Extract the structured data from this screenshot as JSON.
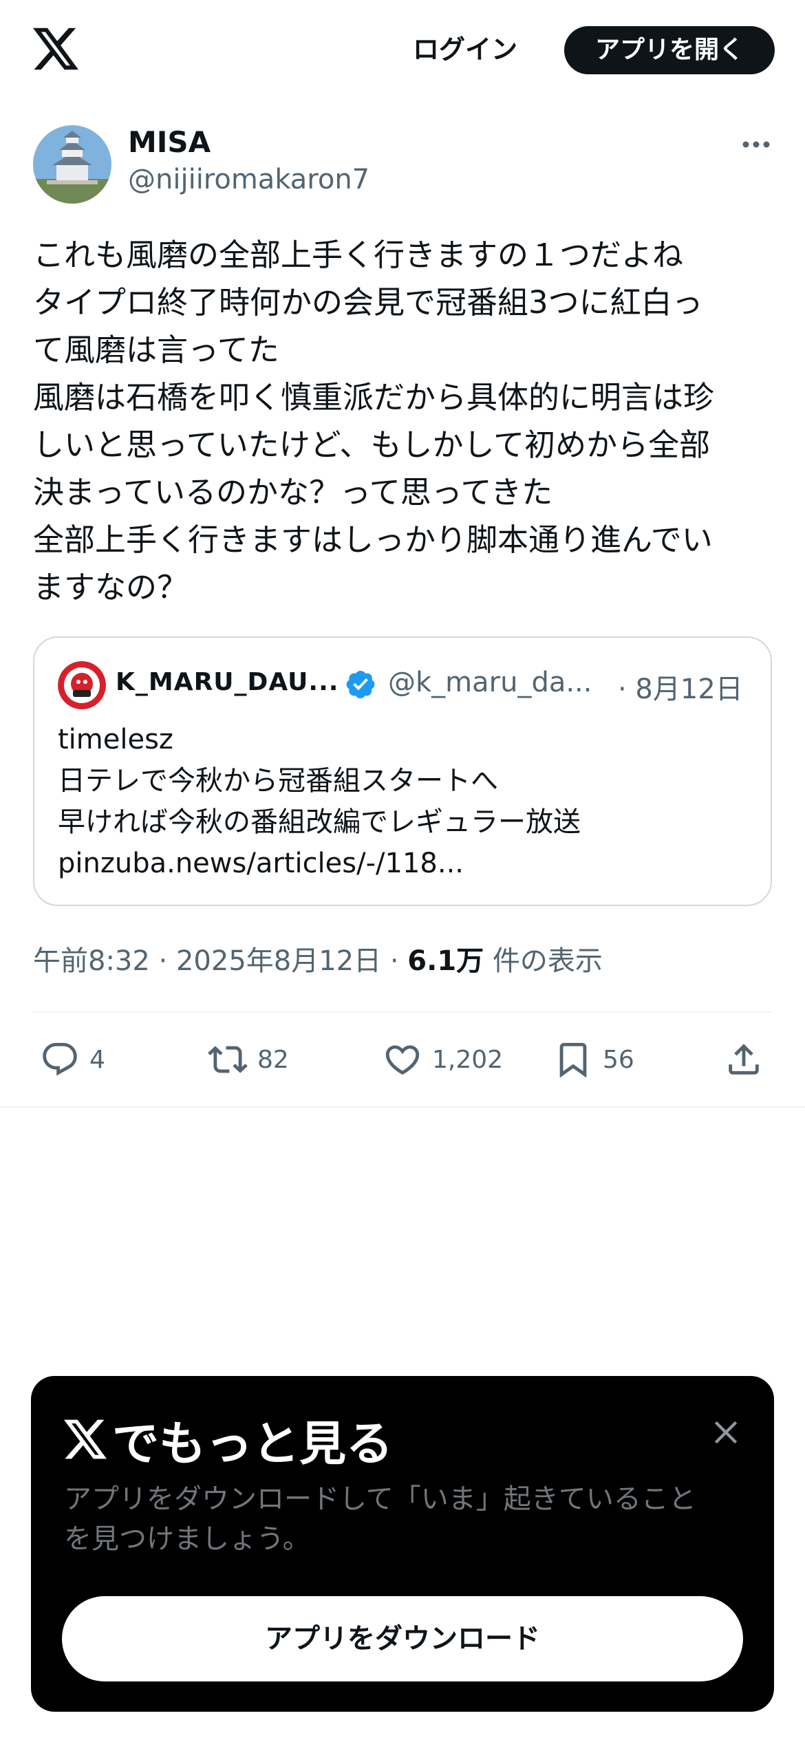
{
  "header": {
    "logo_icon": "x-logo-icon",
    "login_label": "ログイン",
    "open_app_label": "アプリを開く"
  },
  "tweet": {
    "author_name": "MISA",
    "author_handle": "@nijiiromakaron7",
    "text": "これも風磨の全部上手く行きますの１つだよね\nタイプロ終了時何かの会見で冠番組3つに紅白っ\nて風磨は言ってた\n風磨は石橋を叩く慎重派だから具体的に明言は珍\nしいと思っていたけど、もしかして初めから全部\n決まっているのかな？って思ってきた\n全部上手く行きますはしっかり脚本通り進んでい\nますなの？",
    "quote": {
      "name": "K_MARU_DAU...",
      "handle": "@k_maru_da...",
      "date": "· 8月12日",
      "lines": [
        "timelesz",
        "日テレで今秋から冠番組スタートへ",
        "早ければ今秋の番組改編でレギュラー放送",
        "pinzuba.news/articles/-/118..."
      ]
    },
    "meta": {
      "time": "午前8:32",
      "sep1": " · ",
      "date": "2025年8月12日",
      "sep2": " · ",
      "views": "6.1万",
      "views_suffix": " 件の表示"
    },
    "actions": {
      "replies": "4",
      "retweets": "82",
      "likes": "1,202",
      "bookmarks": "56"
    }
  },
  "promo": {
    "title": "でもっと見る",
    "subtitle": "アプリをダウンロードして「いま」起きていること\nを見つけましょう。",
    "button_label": "アプリをダウンロード"
  },
  "colors": {
    "text": "#0f1419",
    "secondary": "#536471",
    "border": "#cfd9de",
    "verified": "#1d9bf0",
    "promo_bg": "#000000"
  }
}
